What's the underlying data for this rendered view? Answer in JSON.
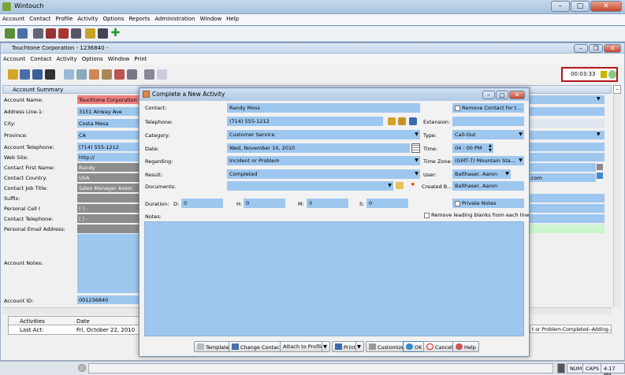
{
  "app": {
    "title": "Wintouch"
  },
  "main_menu": [
    "Account",
    "Contact",
    "Profile",
    "Activity",
    "Options",
    "Reports",
    "Administration",
    "Window",
    "Help"
  ],
  "inner_window": {
    "title": "Touchtone Corporation - 1236840 -",
    "menu": [
      "Account",
      "Contact",
      "Activity",
      "Options",
      "Window",
      "Print"
    ],
    "timer": "00:03:33"
  },
  "summary": {
    "title": "Account Summary",
    "fields": [
      {
        "label": "Account Name:",
        "value": "Touchtone Corporation"
      },
      {
        "label": "Address Line-1:",
        "value": "3151 Airway Ave"
      },
      {
        "label": "City:",
        "value": "Costa Mesa"
      },
      {
        "label": "Province:",
        "value": "CA"
      },
      {
        "label": "Account Telephone:",
        "value": "(714) 555-1212"
      },
      {
        "label": "Web Site:",
        "value": "http://"
      },
      {
        "label": "Contact First Name:",
        "value": "Randy"
      },
      {
        "label": "Contact Country:",
        "value": "USA"
      },
      {
        "label": "Contact Job Title:",
        "value": "Sales Manager Assoc"
      },
      {
        "label": "Suffix:",
        "value": ""
      },
      {
        "label": "Personal Cell (",
        "value": "(  )   -"
      },
      {
        "label": "Contact Telephone:",
        "value": "(  )   -"
      },
      {
        "label": "Personal Email Address:",
        "value": ""
      }
    ],
    "notes_label": "Account Notes:",
    "account_id_label": "Account ID:",
    "account_id": "001236840",
    "right_partial_email": ".com",
    "table_headers": [
      "Activities",
      "Date"
    ],
    "table_row": {
      "label": "Last Act:",
      "date": "Fri, October 22, 2010"
    },
    "right_partial_activity": "t or Problem-Completed--Adding..."
  },
  "dialog": {
    "title": "Complete a New Activity",
    "contact_label": "Contact:",
    "contact": "Randy Moss",
    "remove_contact": "Remove Contact for t...",
    "telephone_label": "Telephone:",
    "telephone": "(714) 555-1212",
    "extension_label": "Extension:",
    "category_label": "Category:",
    "category": "Customer Service",
    "type_label": "Type:",
    "type": "Call-Out",
    "date_label": "Date:",
    "date": "Wed, November 10, 2010",
    "time_label": "Time:",
    "time": "04 : 00   PM",
    "regarding_label": "Regarding:",
    "regarding": "Incident or Problem",
    "timezone_label": "Time Zone:",
    "timezone": "(GMT-7) Mountain Sta...",
    "result_label": "Result:",
    "result": "Completed",
    "user_label": "User:",
    "user": "Balthaser, Aaron",
    "documents_label": "Documents:",
    "created_by_label": "Created B...",
    "created_by": "Balthaser, Aaron",
    "duration_label": "Duration:",
    "d_label": "D:",
    "d": "0",
    "h_label": "H:",
    "h": "0",
    "m_label": "M:",
    "m": "0",
    "s_label": "S:",
    "s": "0",
    "private_notes": "Private Notes",
    "notes_label": "Notes:",
    "remove_blanks": "Remove leading blanks from each line",
    "buttons": {
      "template": "Template",
      "change_contact": "Change Contact",
      "attach": "Attach to Profile",
      "print": "Print",
      "customize": "Customize",
      "ok": "OK",
      "cancel": "Cancel",
      "help": "Help"
    }
  },
  "statusbar": {
    "num": "NUM",
    "caps": "CAPS",
    "time": "4:17 PM"
  }
}
